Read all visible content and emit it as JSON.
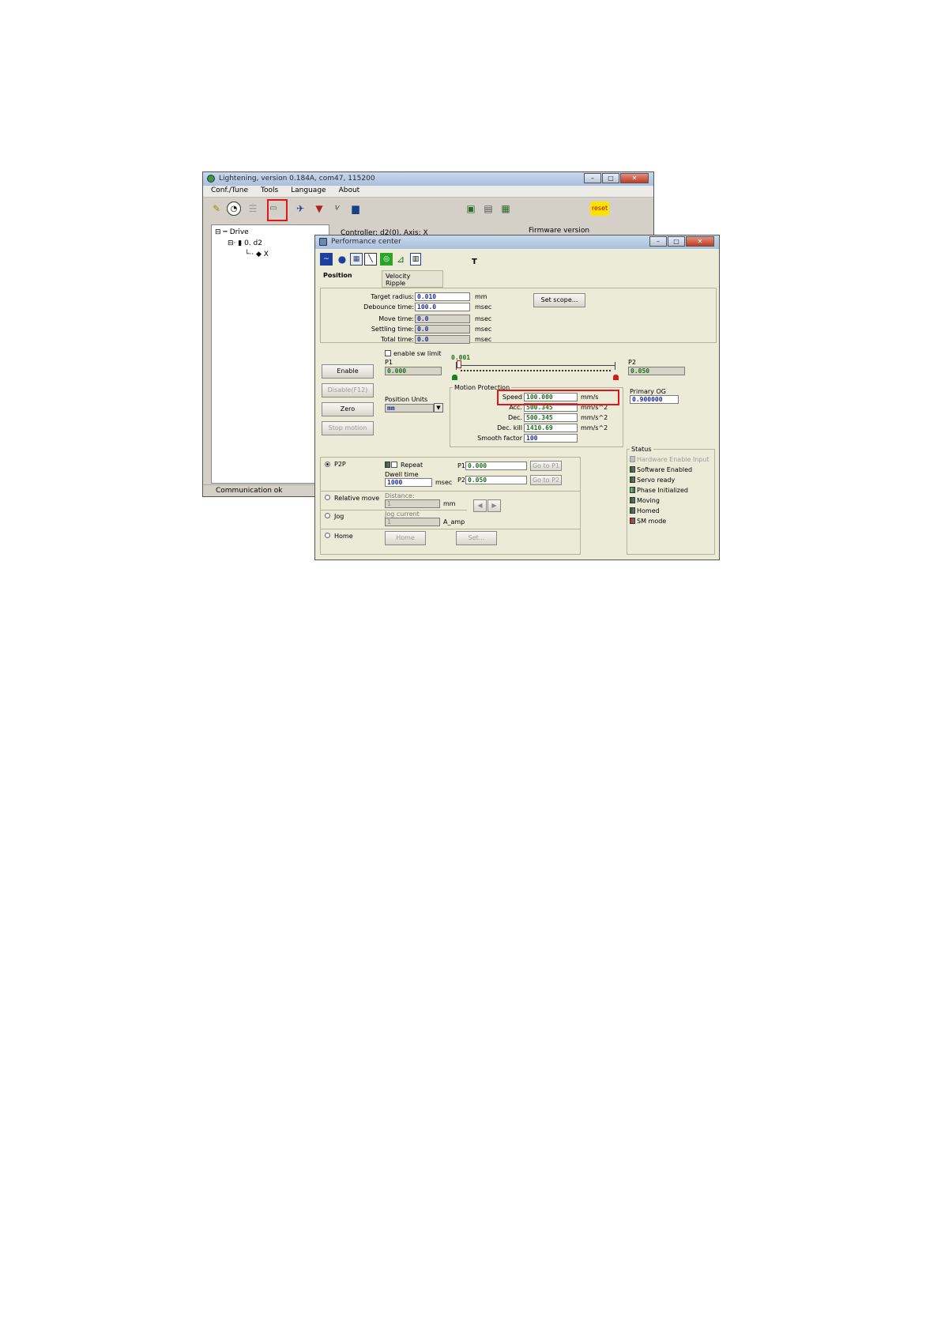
{
  "main_window": {
    "title": "Lightening, version 0.184A, com47, 115200",
    "menu": [
      "Conf./Tune",
      "Tools",
      "Language",
      "About"
    ],
    "toolbar": {
      "reset_label": "reset"
    },
    "tree": {
      "root": "Drive",
      "device": "0. d2",
      "axis": "X"
    },
    "info": {
      "controller": "Controller: d2(0), Axis: X",
      "firmware": "Firmware version"
    },
    "status": "Communication ok"
  },
  "perf": {
    "title": "Performance center",
    "toolbar_label": "T",
    "tabs": [
      "Position",
      "Velocity\nRipple"
    ],
    "timing": {
      "target_radius_label": "Target radius:",
      "target_radius": "0.010",
      "target_radius_unit": "mm",
      "debounce_label": "Debounce time:",
      "debounce": "100.0",
      "debounce_unit": "msec",
      "move_label": "Move time:",
      "move": "0.0",
      "move_unit": "msec",
      "settling_label": "Settling time:",
      "settling": "0.0",
      "settling_unit": "msec",
      "total_label": "Total time:",
      "total": "0.0",
      "total_unit": "msec",
      "set_scope_label": "Set scope..."
    },
    "controls": {
      "enable": "Enable",
      "disable": "Disable(F12)",
      "zero": "Zero",
      "stop": "Stop motion",
      "sw_limit_label": "enable sw limit",
      "p1_label": "P1",
      "p1": "0.000",
      "p2_label": "P2",
      "p2": "0.050",
      "slider_value": "0.001",
      "position_units_label": "Position Units",
      "position_units": "mm",
      "primary_og_label": "Primary OG",
      "primary_og": "0.900000"
    },
    "motion": {
      "group_label": "Motion Protection",
      "speed_label": "Speed",
      "speed": "100.000",
      "speed_unit": "mm/s",
      "acc_label": "Acc.",
      "acc": "500.345",
      "acc_unit": "mm/s^2",
      "dec_label": "Dec.",
      "dec": "500.345",
      "dec_unit": "mm/s^2",
      "deckill_label": "Dec. kill",
      "deckill": "1410.69",
      "deckill_unit": "mm/s^2",
      "smooth_label": "Smooth factor",
      "smooth": "100"
    },
    "moves": {
      "p2p_label": "P2P",
      "repeat_label": "Repeat",
      "dwell_label": "Dwell time",
      "dwell": "1000",
      "dwell_unit": "msec",
      "p1_label": "P1",
      "p1": "0.000",
      "goto_p1": "Go to P1",
      "p2_label": "P2",
      "p2": "0.050",
      "goto_p2": "Go to P2",
      "relative_label": "Relative move",
      "distance_label": "Distance:",
      "distance": "1",
      "distance_unit": "mm",
      "jog_label": "Jog",
      "jog_current_label": "Jog current",
      "jog_current": "1",
      "jog_current_unit": "A_amp",
      "home_label": "Home",
      "home_button": "Home",
      "set_button": "Set..."
    },
    "status": {
      "group_label": "Status",
      "items": [
        "Hardware Enable Input",
        "Software Enabled",
        "Servo ready",
        "Phase Initialized",
        "Moving",
        "Homed",
        "SM mode"
      ]
    }
  }
}
